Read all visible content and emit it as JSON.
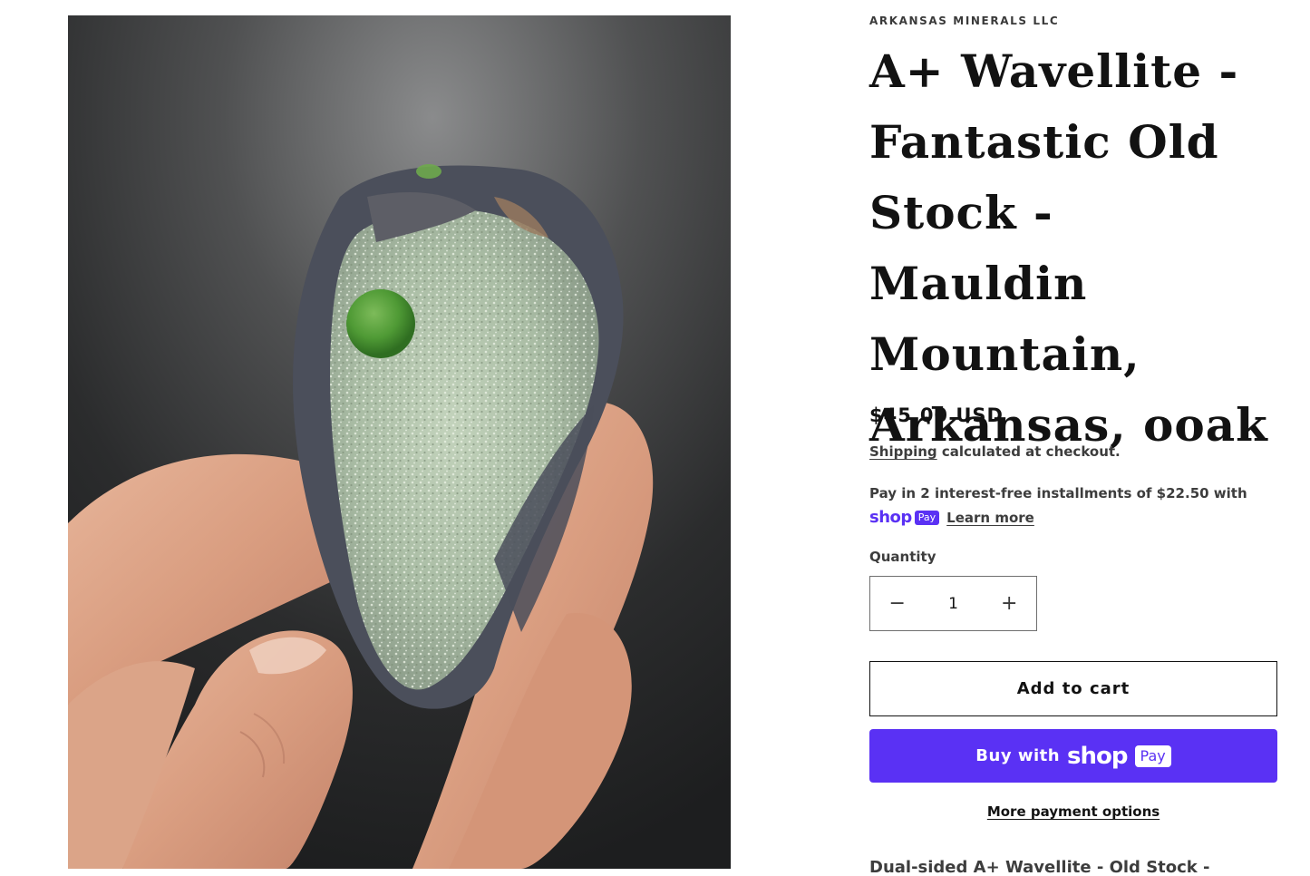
{
  "product": {
    "vendor": "ARKANSAS MINERALS LLC",
    "title": "A+ Wavellite - Fantastic Old Stock - Mauldin Mountain, Arkansas, ooak",
    "price": "$45.00 USD",
    "shipping_link": "Shipping",
    "shipping_rest": " calculated at checkout.",
    "installments_text": "Pay in 2 interest-free installments of $22.50 with",
    "shoppay_shop": "shop",
    "shoppay_pay": "Pay",
    "learn_more": "Learn more",
    "quantity_label": "Quantity",
    "quantity_value": "1",
    "minus_symbol": "−",
    "plus_symbol": "+",
    "add_to_cart": "Add to cart",
    "buy_with": "Buy with",
    "buy_shop": "shop",
    "buy_pay": "Pay",
    "more_payment": "More payment options",
    "description_start": "Dual-sided A+ Wavellite - Old Stock -"
  },
  "colors": {
    "shop_purple": "#5a31f4",
    "text_dark": "#121212"
  }
}
